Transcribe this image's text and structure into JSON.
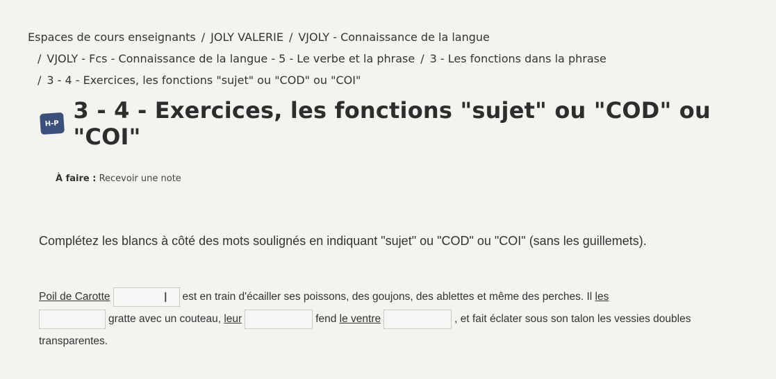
{
  "breadcrumb": {
    "items": [
      "Espaces de cours enseignants",
      "JOLY VALERIE",
      "VJOLY - Connaissance de la langue",
      "VJOLY - Fcs - Connaissance de la langue - 5 - Le verbe et la phrase",
      "3 - Les fonctions dans la phrase",
      "3 - 4 - Exercices, les fonctions \"sujet\" ou \"COD\" ou \"COI\""
    ],
    "separator": "/"
  },
  "header": {
    "icon_label": "H-P",
    "title": "3 - 4 - Exercices, les fonctions \"sujet\" ou \"COD\" ou \"COI\""
  },
  "todo": {
    "label": "À faire :",
    "value": "Recevoir une note"
  },
  "instructions": "Complétez les blancs à côté des mots soulignés en indiquant \"sujet\" ou \"COD\" ou \"COI\" (sans les guillemets).",
  "exercise": {
    "s1": "Poil de Carotte",
    "t1": "est en train d'écailler ses poissons, des goujons, des ablettes et même des perches. Il",
    "s2": "les",
    "t2": "gratte avec un couteau,",
    "s3": "leur",
    "t3": "fend",
    "s4": "le ventre",
    "t4": ", et fait éclater sous son talon les vessies doubles transparentes.",
    "blanks": [
      "",
      "",
      "",
      ""
    ]
  },
  "icons": {
    "header": "hp-icon",
    "cursor": "text-cursor-icon"
  }
}
